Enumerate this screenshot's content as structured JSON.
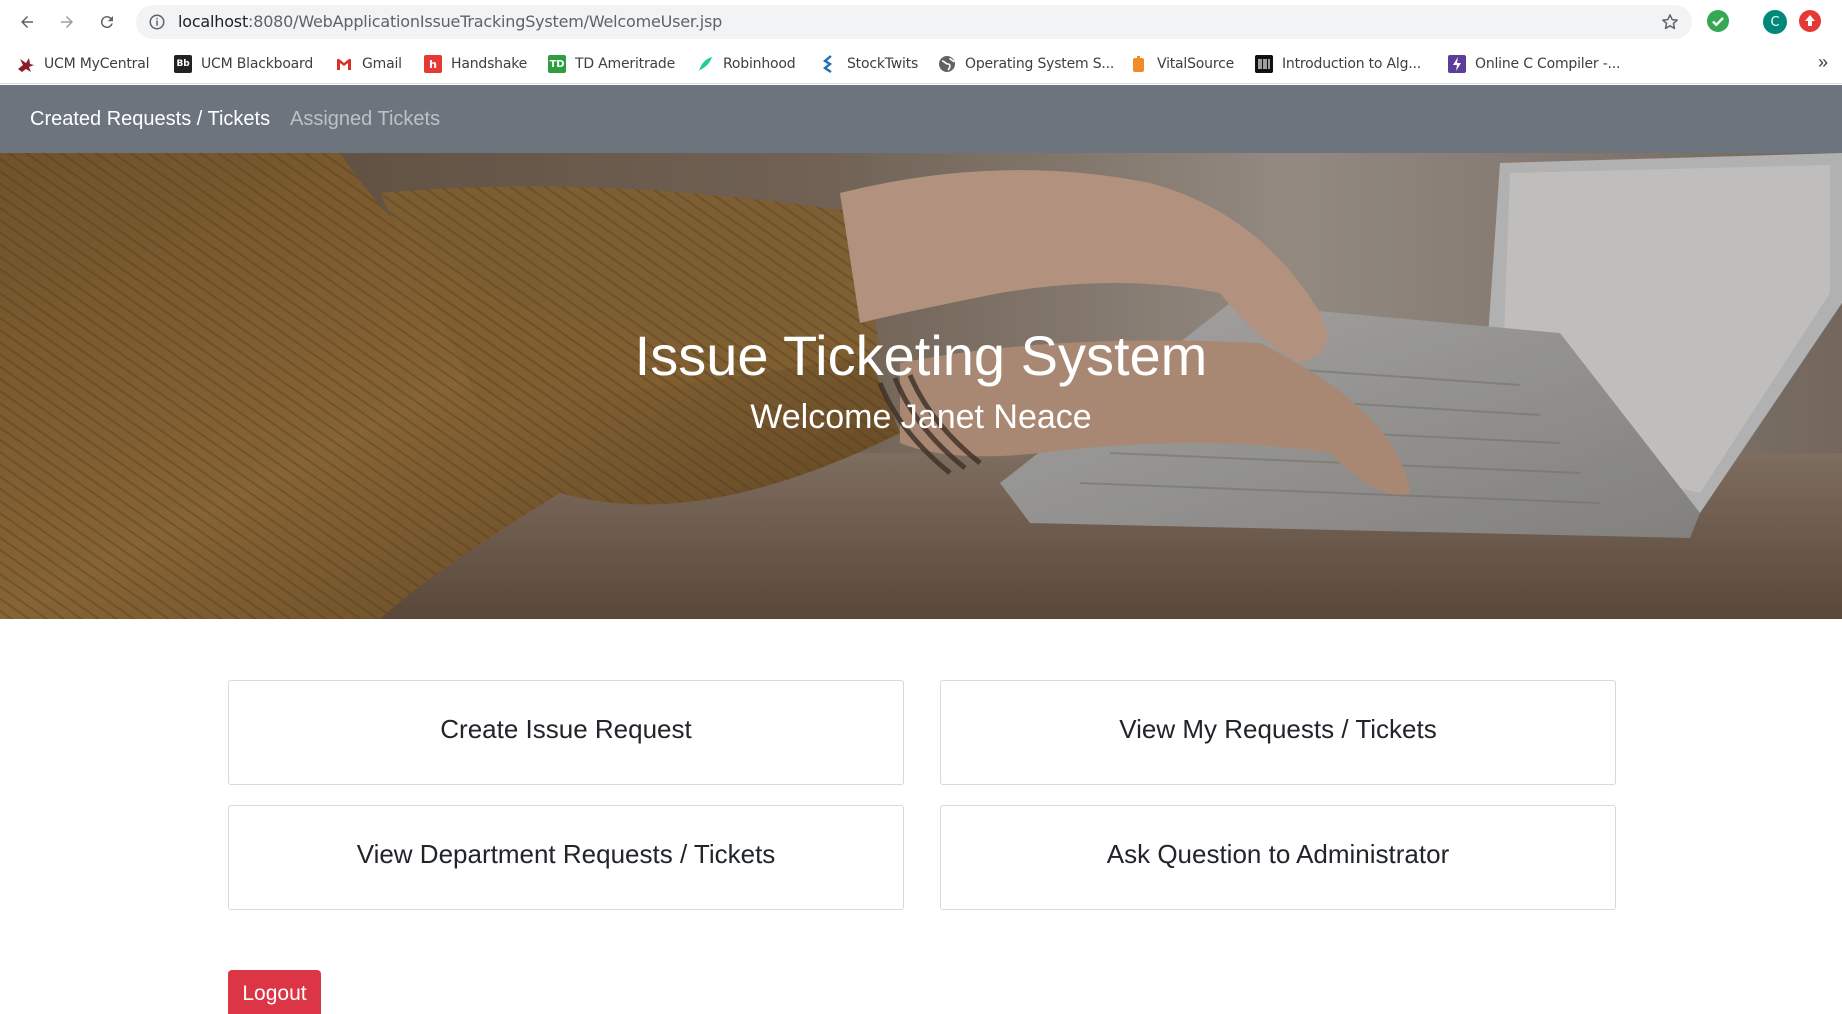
{
  "browser": {
    "url_host": "localhost",
    "url_rest": ":8080/WebApplicationIssueTrackingSystem/WelcomeUser.jsp",
    "profile_initial": "C"
  },
  "bookmarks": [
    {
      "label": "UCM MyCentral",
      "icon": "ucm-bobcat-icon"
    },
    {
      "label": "UCM Blackboard",
      "icon": "blackboard-icon"
    },
    {
      "label": "Gmail",
      "icon": "gmail-icon"
    },
    {
      "label": "Handshake",
      "icon": "handshake-icon"
    },
    {
      "label": "TD Ameritrade",
      "icon": "td-icon"
    },
    {
      "label": "Robinhood",
      "icon": "robinhood-feather-icon"
    },
    {
      "label": "StockTwits",
      "icon": "stocktwits-icon"
    },
    {
      "label": "Operating System S...",
      "icon": "globe-icon"
    },
    {
      "label": "VitalSource",
      "icon": "vitalsource-icon"
    },
    {
      "label": "Introduction to Alg...",
      "icon": "barcode-book-icon"
    },
    {
      "label": "Online C Compiler -...",
      "icon": "compiler-bolt-icon"
    }
  ],
  "navbar": {
    "active_label": "Created Requests / Tickets",
    "inactive_label": "Assigned Tickets"
  },
  "hero": {
    "title": "Issue Ticketing System",
    "welcome": "Welcome Janet Neace"
  },
  "cards": {
    "create": "Create Issue Request",
    "view_my": "View My Requests / Tickets",
    "view_dept": "View Department Requests / Tickets",
    "ask": "Ask Question to Administrator"
  },
  "logout_label": "Logout",
  "colors": {
    "navbar": "#6c757d",
    "logout": "#dc3545"
  }
}
